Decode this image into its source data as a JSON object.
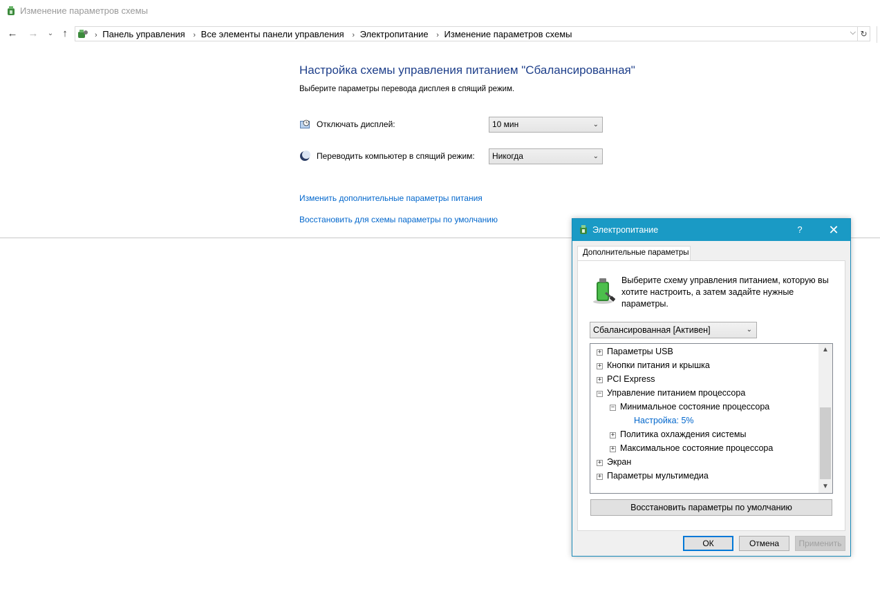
{
  "window": {
    "title": "Изменение параметров схемы"
  },
  "nav": {
    "breadcrumbs": [
      "Панель управления",
      "Все элементы панели управления",
      "Электропитание",
      "Изменение параметров схемы"
    ]
  },
  "main": {
    "heading": "Настройка схемы управления питанием \"Сбалансированная\"",
    "subtext": "Выберите параметры перевода дисплея в спящий режим.",
    "display_label": "Отключать дисплей:",
    "display_value": "10 мин",
    "sleep_label": "Переводить компьютер в спящий режим:",
    "sleep_value": "Никогда",
    "link_advanced": "Изменить дополнительные параметры питания",
    "link_restore": "Восстановить для схемы параметры по умолчанию"
  },
  "dialog": {
    "title": "Электропитание",
    "help": "?",
    "close": "✕",
    "tab": "Дополнительные параметры",
    "description": "Выберите схему управления питанием, которую вы хотите настроить, а затем задайте нужные параметры.",
    "scheme": "Сбалансированная [Активен]",
    "tree": [
      {
        "label": "Параметры USB",
        "level": 0,
        "state": "+"
      },
      {
        "label": "Кнопки питания и крышка",
        "level": 0,
        "state": "+"
      },
      {
        "label": "PCI Express",
        "level": 0,
        "state": "+"
      },
      {
        "label": "Управление питанием процессора",
        "level": 0,
        "state": "−"
      },
      {
        "label": "Минимальное состояние процессора",
        "level": 1,
        "state": "−"
      },
      {
        "label": "Настройка: 5%",
        "level": 2,
        "state": "setting"
      },
      {
        "label": "Политика охлаждения системы",
        "level": 1,
        "state": "+"
      },
      {
        "label": "Максимальное состояние процессора",
        "level": 1,
        "state": "+"
      },
      {
        "label": "Экран",
        "level": 0,
        "state": "+"
      },
      {
        "label": "Параметры мультимедиа",
        "level": 0,
        "state": "+"
      }
    ],
    "restore_button": "Восстановить параметры по умолчанию",
    "ok": "ОК",
    "cancel": "Отмена",
    "apply": "Применить"
  }
}
